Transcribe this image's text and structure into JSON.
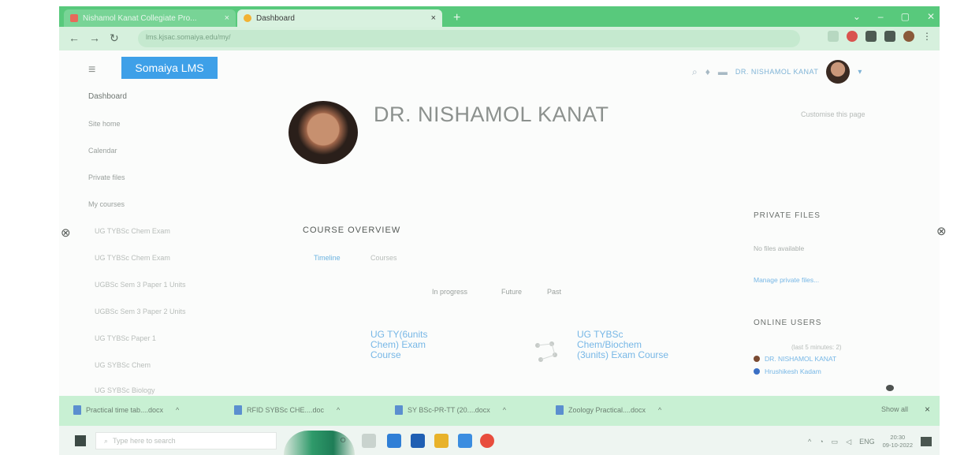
{
  "browser": {
    "tabs": [
      {
        "label": "Nishamol Kanat Collegiate Pro...",
        "close": "×"
      },
      {
        "label": "Dashboard",
        "close": "×"
      }
    ],
    "new_tab": "+",
    "url": "lms.kjsac.somaiya.edu/my/"
  },
  "header": {
    "menu_icon": "≡",
    "brand": "Somaiya LMS",
    "user": "DR. NISHAMOL KANAT",
    "caret": "▾"
  },
  "nav": {
    "dashboard": "Dashboard",
    "items": [
      "Site home",
      "Calendar",
      "Private files",
      "My courses"
    ],
    "courses": [
      "UG TYBSc Chem Exam",
      "UG TYBSc Chem Exam",
      "UGBSc Sem 3 Paper 1 Units",
      "UGBSc Sem 3 Paper 2 Units",
      "UG TYBSc Paper 1",
      "UG SYBSc Chem",
      "UG SYBSc Biology"
    ]
  },
  "profile": {
    "name": "DR. NISHAMOL KANAT",
    "customise": "Customise this page"
  },
  "overview": {
    "title": "COURSE OVERVIEW",
    "tabs": [
      "Timeline",
      "Courses"
    ],
    "filters": [
      "In progress",
      "Future",
      "Past"
    ],
    "courses": [
      "UG TY(6units Chem) Exam Course",
      "UG TYBSc Chem/Biochem (3units) Exam Course"
    ]
  },
  "private_files": {
    "title": "PRIVATE FILES",
    "empty": "No files available",
    "manage": "Manage private files..."
  },
  "online_users": {
    "title": "ONLINE USERS",
    "window": "(last 5 minutes: 2)",
    "users": [
      "DR. NISHAMOL KANAT",
      "Hrushikesh Kadam"
    ]
  },
  "downloads": {
    "items": [
      "Practical time tab....docx",
      "RFID SYBSc CHE....doc",
      "SY BSc-PR-TT (20....docx",
      "Zoology Practical....docx"
    ],
    "show_all": "Show all",
    "close": "×"
  },
  "taskbar": {
    "search_placeholder": "Type here to search",
    "lang": "ENG",
    "time": "20:30",
    "date": "09-10-2022"
  },
  "colors": {
    "tab_strip": "#58c97c",
    "brand": "#3ea0e8",
    "link": "#77b7e6"
  }
}
